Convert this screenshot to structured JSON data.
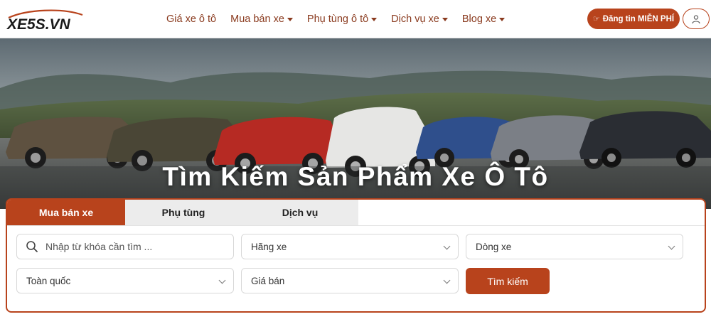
{
  "header": {
    "logo_text": "XE5S.VN",
    "nav": [
      {
        "label": "Giá xe ô tô",
        "dropdown": false
      },
      {
        "label": "Mua bán xe",
        "dropdown": true
      },
      {
        "label": "Phụ tùng ô tô",
        "dropdown": true
      },
      {
        "label": "Dịch vụ xe",
        "dropdown": true
      },
      {
        "label": "Blog xe",
        "dropdown": true
      }
    ],
    "post_button": "Đăng tin MIỄN PHÍ",
    "user_icon": "user-icon"
  },
  "hero": {
    "title": "Tìm Kiếm Sản Phẩm Xe Ô Tô"
  },
  "search": {
    "tabs": [
      "Mua bán xe",
      "Phụ tùng",
      "Dịch vụ"
    ],
    "active_tab": "Mua bán xe",
    "keyword_placeholder": "Nhập từ khóa cần tìm ...",
    "brand": "Hãng xe",
    "model": "Dòng xe",
    "region": "Toàn quốc",
    "price": "Giá bán",
    "submit": "Tìm kiếm"
  },
  "colors": {
    "brand": "#b8431c",
    "nav_text": "#8a3a1e",
    "tab_inactive": "#ececec"
  }
}
